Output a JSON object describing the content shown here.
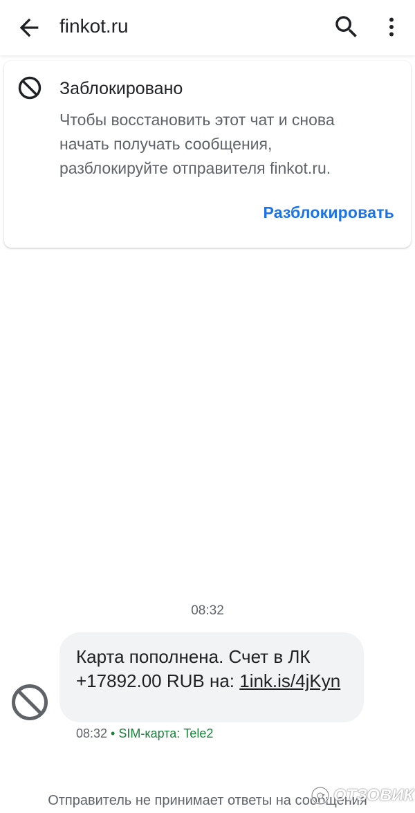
{
  "appbar": {
    "title": "finkot.ru",
    "back_icon": "arrow-back-icon",
    "search_icon": "search-icon",
    "more_icon": "more-vert-icon"
  },
  "blocked_card": {
    "icon": "block-icon",
    "title": "Заблокировано",
    "text": "Чтобы восстановить этот чат и снова начать получать сообщения, разблокируйте отправителя finkot.ru.",
    "unblock_label": "Разблокировать"
  },
  "conversation": {
    "timestamp": "08:32",
    "message": {
      "text_before_link": "Карта пополнена. Счет в ЛК +17892.00 RUB на: ",
      "link": "1ink.is/4jKyn",
      "time": "08:32",
      "separator": " • ",
      "sim": "SIM-карта: Tele2"
    }
  },
  "footer": {
    "note": "Отправитель не принимает ответы на сообщения"
  },
  "watermark": {
    "text": "ОТЗОВИК"
  },
  "colors": {
    "accent": "#1a73e8",
    "sim": "#188038",
    "bubble": "#f1f3f4",
    "secondary_text": "#5f6368"
  }
}
